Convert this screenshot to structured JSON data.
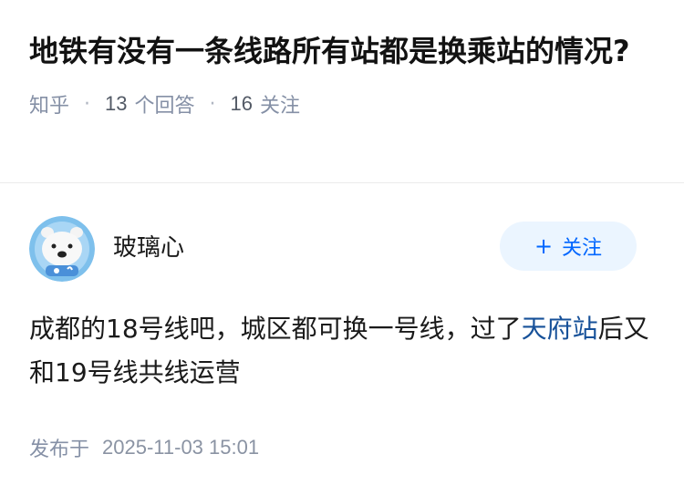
{
  "question": {
    "title": "地铁有没有一条线路所有站都是换乘站的情况?",
    "source": "知乎",
    "answer_count": "13",
    "answer_label": "个回答",
    "follower_count": "16",
    "follower_label": "关注"
  },
  "answer": {
    "author_name": "玻璃心",
    "follow_button": {
      "plus": "+",
      "label": "关注"
    },
    "content_before": "成都的18号线吧，城区都可换一号线，过了",
    "content_link": "天府站",
    "content_after": "后又和19号线共线运营",
    "published_label": "发布于",
    "published_date": "2025-11-03 15:01"
  },
  "colors": {
    "accent": "#0066ff",
    "link": "#175199",
    "follow_bg": "#ebf5ff",
    "meta": "#8590a6",
    "avatar_bg": "#6fb3e6"
  },
  "icons": {
    "avatar": "cartoon-bear-avatar-icon"
  }
}
